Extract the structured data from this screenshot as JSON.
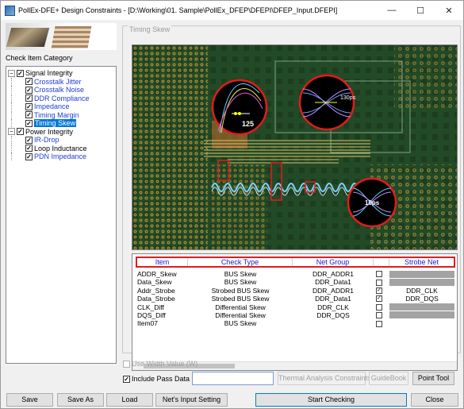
{
  "window": {
    "title": "PollEx-DFE+ Design Constraints - [D:\\Working\\01. Sample\\PollEx_DFEP\\DFEPI\\DFEP_Input.DFEPI]"
  },
  "left": {
    "category_label": "Check Item Category",
    "tree": [
      {
        "label": "Signal Integrity",
        "level": 0,
        "checked": true,
        "expander": "−",
        "style": "normal"
      },
      {
        "label": "Crosstalk Jitter",
        "level": 1,
        "checked": true,
        "style": "link"
      },
      {
        "label": "Crosstalk Noise",
        "level": 1,
        "checked": true,
        "style": "link"
      },
      {
        "label": "DDR Compliance",
        "level": 1,
        "checked": true,
        "style": "link"
      },
      {
        "label": "Impedance",
        "level": 1,
        "checked": true,
        "style": "link"
      },
      {
        "label": "Timing Margin",
        "level": 1,
        "checked": true,
        "style": "link"
      },
      {
        "label": "Timing Skew",
        "level": 1,
        "checked": true,
        "style": "selected"
      },
      {
        "label": "Power Integrity",
        "level": 0,
        "checked": true,
        "expander": "−",
        "style": "normal"
      },
      {
        "label": "IR-Drop",
        "level": 1,
        "checked": true,
        "style": "link"
      },
      {
        "label": "Loop Inductance",
        "level": 1,
        "checked": true,
        "style": "normal"
      },
      {
        "label": "PDN Impedance",
        "level": 1,
        "checked": true,
        "style": "link"
      }
    ]
  },
  "group": {
    "title": "Timing Skew",
    "pcb_annotations": {
      "a": "125",
      "b": "130ps",
      "c": "10ps"
    }
  },
  "grid": {
    "columns": [
      "Item",
      "Check Type",
      "Net Group",
      "",
      "Strobe Net"
    ],
    "rows": [
      {
        "item": "ADDR_Skew",
        "check": "BUS Skew",
        "net": "DDR_ADDR1",
        "cb": false,
        "strobe": "",
        "strobe_gray": true
      },
      {
        "item": "Data_Skew",
        "check": "BUS Skew",
        "net": "DDR_Data1",
        "cb": false,
        "strobe": "",
        "strobe_gray": true
      },
      {
        "item": "Addr_Strobe",
        "check": "Strobed BUS Skew",
        "net": "DDR_ADDR1",
        "cb": true,
        "strobe": "DDR_CLK",
        "strobe_gray": false
      },
      {
        "item": "Data_Strobe",
        "check": "Strobed BUS Skew",
        "net": "DDR_Data1",
        "cb": true,
        "strobe": "DDR_DQS",
        "strobe_gray": false
      },
      {
        "item": "CLK_Diff",
        "check": "Differential Skew",
        "net": "DDR_CLK",
        "cb": false,
        "strobe": "",
        "strobe_gray": true
      },
      {
        "item": "DQS_Diff",
        "check": "Differential Skew",
        "net": "DDR_DQS",
        "cb": false,
        "strobe": "",
        "strobe_gray": true
      },
      {
        "item": "Item07",
        "check": "BUS Skew",
        "net": "",
        "cb": false,
        "strobe": "",
        "strobe_gray": false
      }
    ]
  },
  "options": {
    "use_width_value": "Use Width Value (W)",
    "use_width_checked": false,
    "include_pass_data": "Include Pass Data",
    "include_pass_checked": true,
    "thermal_btn": "Thermal Analysis Constraints",
    "guidebook_btn": "GuideBook",
    "point_tool_btn": "Point Tool"
  },
  "footer": {
    "save": "Save",
    "save_as": "Save As",
    "load": "Load",
    "nets_input": "Net's Input Setting",
    "start": "Start Checking",
    "close": "Close"
  },
  "colors": {
    "link": "#1e3fd1",
    "selected_bg": "#0078d7",
    "header_border": "#e21c1c",
    "pcb_bg": "#1e3a20"
  }
}
